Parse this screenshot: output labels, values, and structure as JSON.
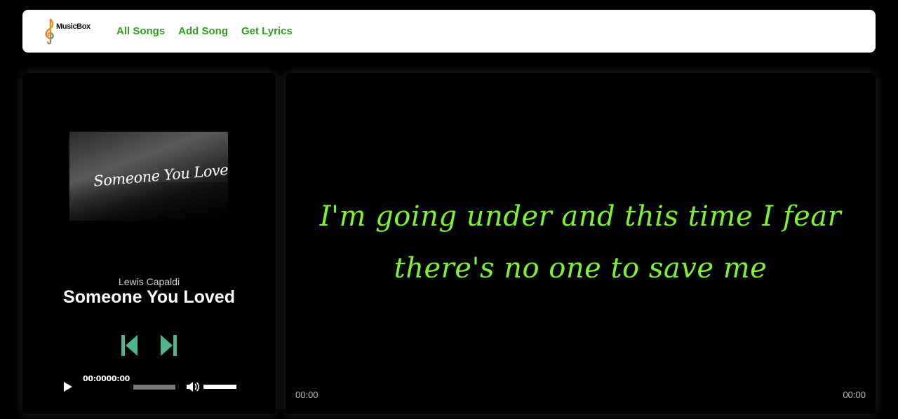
{
  "nav": {
    "logo_text": "MusicBox",
    "links": [
      "All Songs",
      "Add Song",
      "Get Lyrics"
    ],
    "link_color": "#2f9e1b"
  },
  "player": {
    "cover_title": "Someone You Loved",
    "artist": "Lewis Capaldi",
    "title": "Someone You Loved",
    "control_color": "#4fb58a",
    "audio": {
      "time_display": "00:0000:00",
      "progress": 0,
      "volume": 1
    }
  },
  "lyrics": {
    "lines": [
      "I'm going under and this time I fear",
      "there's no one to save me"
    ],
    "color": "#7ef22c",
    "current_time": "00:00",
    "duration": "00:00"
  }
}
